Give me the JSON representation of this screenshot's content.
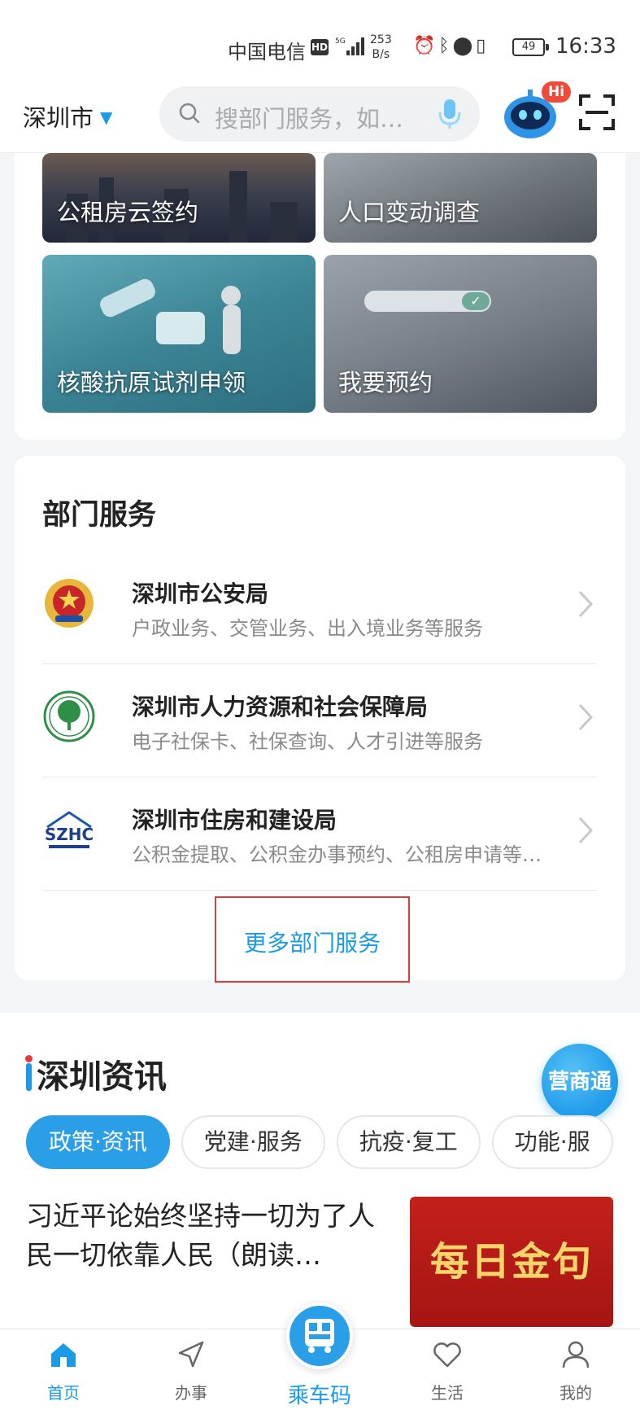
{
  "status_bar": {
    "carrier": "中国电信",
    "hd": "HD",
    "speed_value": "253",
    "speed_unit": "B/s",
    "battery": "49",
    "time": "16:33"
  },
  "topnav": {
    "city": "深圳市",
    "search_placeholder": "搜部门服务，如…",
    "hi_badge": "Hi"
  },
  "tiles": [
    {
      "label": "公租房云签约"
    },
    {
      "label": "人口变动调查"
    },
    {
      "label": "核酸抗原试剂申领"
    },
    {
      "label": "我要预约"
    }
  ],
  "dept": {
    "title": "部门服务",
    "items": [
      {
        "name": "深圳市公安局",
        "desc": "户政业务、交管业务、出入境业务等服务",
        "logo": "police-emblem-icon"
      },
      {
        "name": "深圳市人力资源和社会保障局",
        "desc": "电子社保卡、社保查询、人才引进等服务",
        "logo": "tree-emblem-icon"
      },
      {
        "name": "深圳市住房和建设局",
        "desc": "公积金提取、公积金办事预约、公租房申请等…",
        "logo": "szhc-logo-icon"
      }
    ],
    "more_label": "更多部门服务",
    "highlight_color": "#e03a3a"
  },
  "news": {
    "logo_text": "深圳资讯",
    "float_button": "营商通",
    "chips": [
      "政策·资讯",
      "党建·服务",
      "抗疫·复工",
      "功能·服"
    ],
    "article_title": "习近平论始终坚持一切为了人民一切依靠人民（朗读…",
    "article_image_text": "每日金句"
  },
  "tabbar": {
    "items": [
      {
        "label": "首页",
        "icon": "home-icon"
      },
      {
        "label": "办事",
        "icon": "send-icon"
      },
      {
        "label": "乘车码",
        "icon": "bus-code-icon"
      },
      {
        "label": "生活",
        "icon": "heart-icon"
      },
      {
        "label": "我的",
        "icon": "person-icon"
      }
    ],
    "accent": "#1a9be8"
  }
}
